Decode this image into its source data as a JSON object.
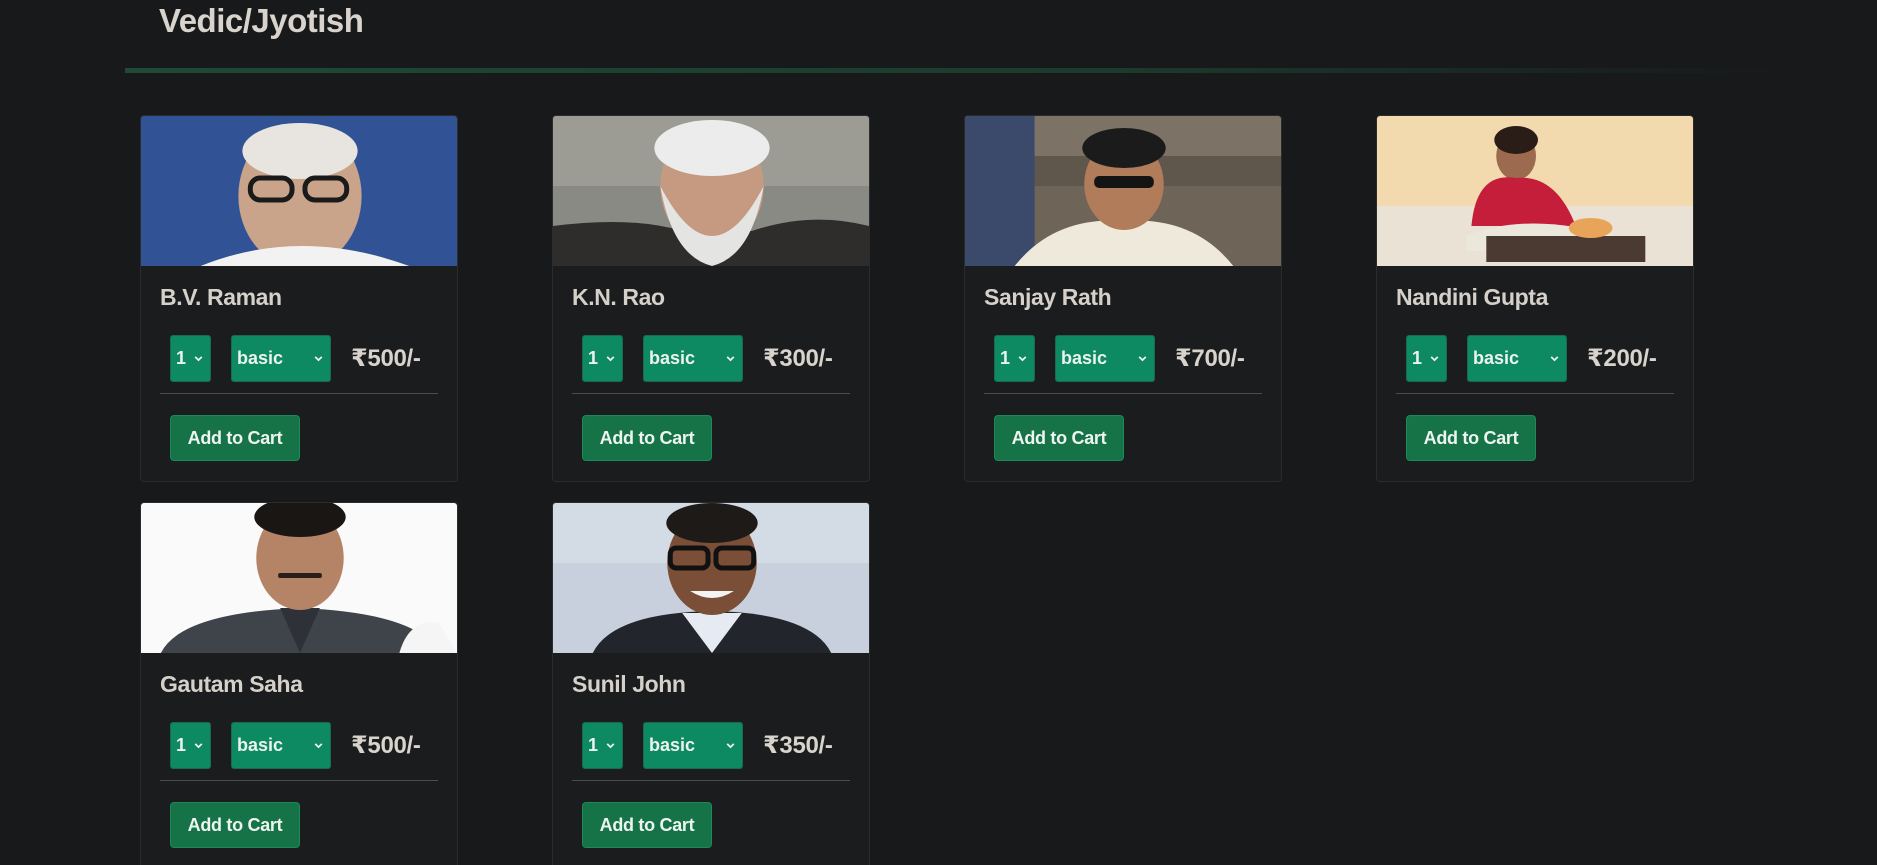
{
  "section": {
    "title": "Vedic/Jyotish"
  },
  "products": [
    {
      "name": "B.V. Raman",
      "quantity": "1",
      "plan": "basic",
      "price": "₹500/-",
      "button": "Add to Cart",
      "photo_icon": "portrait-photo"
    },
    {
      "name": "K.N. Rao",
      "quantity": "1",
      "plan": "basic",
      "price": "₹300/-",
      "button": "Add to Cart",
      "photo_icon": "portrait-photo"
    },
    {
      "name": "Sanjay Rath",
      "quantity": "1",
      "plan": "basic",
      "price": "₹700/-",
      "button": "Add to Cart",
      "photo_icon": "portrait-photo"
    },
    {
      "name": "Nandini Gupta",
      "quantity": "1",
      "plan": "basic",
      "price": "₹200/-",
      "button": "Add to Cart",
      "photo_icon": "portrait-photo"
    },
    {
      "name": "Gautam Saha",
      "quantity": "1",
      "plan": "basic",
      "price": "₹500/-",
      "button": "Add to Cart",
      "photo_icon": "portrait-photo"
    },
    {
      "name": "Sunil John",
      "quantity": "1",
      "plan": "basic",
      "price": "₹350/-",
      "button": "Add to Cart",
      "photo_icon": "portrait-photo"
    }
  ],
  "colors": {
    "background": "#18191b",
    "select_bg": "#0d8a62",
    "button_bg": "#157347",
    "divider": "#1e4a37"
  }
}
